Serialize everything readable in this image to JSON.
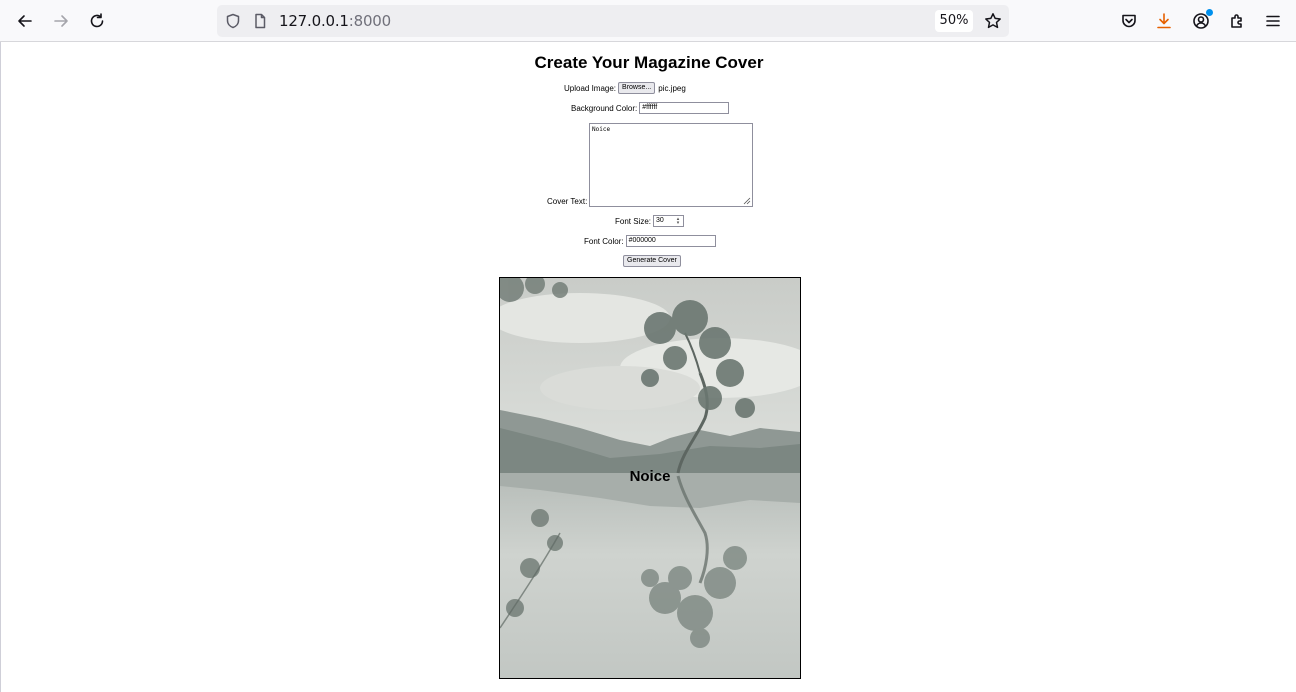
{
  "browser": {
    "url_host": "127.0.0.1",
    "url_port": ":8000",
    "zoom": "50%"
  },
  "form": {
    "title": "Create Your Magazine Cover",
    "upload_label": "Upload Image:",
    "browse_label": "Browse...",
    "file_name": "pic.jpeg",
    "bg_color_label": "Background Color:",
    "bg_color_value": "#ffffff",
    "cover_text_label": "Cover Text:",
    "cover_text_value": "Noice",
    "font_size_label": "Font Size:",
    "font_size_value": "30",
    "font_color_label": "Font Color:",
    "font_color_value": "#000000",
    "generate_label": "Generate Cover"
  },
  "cover": {
    "text": "Noice",
    "text_color": "#000000",
    "image_description": "lone tree reflected in misty lake"
  },
  "icons": {
    "back": "back-arrow-icon",
    "forward": "forward-arrow-icon",
    "reload": "reload-icon",
    "shield": "shield-icon",
    "page": "page-icon",
    "star": "bookmark-star-icon",
    "pocket": "pocket-icon",
    "download": "download-icon",
    "account": "account-icon",
    "extensions": "extensions-icon",
    "menu": "hamburger-menu-icon"
  },
  "colors": {
    "download_accent": "#e66000",
    "notification_dot": "#0090ed"
  }
}
